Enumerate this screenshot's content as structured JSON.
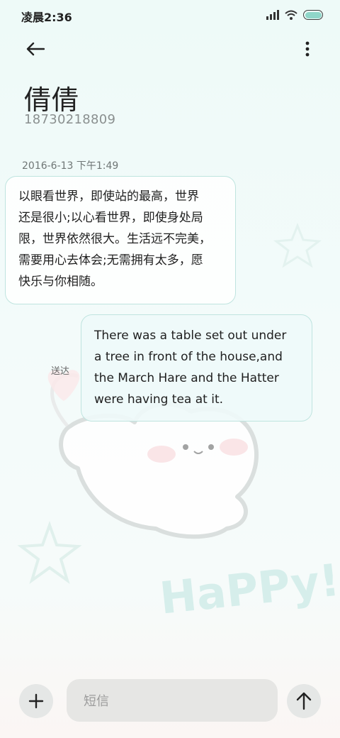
{
  "status_bar": {
    "time": "凌晨2:36",
    "icons": [
      "signal-icon",
      "wifi-icon",
      "battery-icon"
    ],
    "battery_color": "#8fd6c9"
  },
  "header": {
    "back_icon": "arrow-left-icon",
    "more_icon": "more-vertical-icon",
    "contact_name": "倩倩",
    "contact_number": "18730218809"
  },
  "conversation": {
    "timestamp": "2016-6-13 下午1:49",
    "messages": [
      {
        "direction": "incoming",
        "lines": [
          "以眼看世界，即使站的最高，世界",
          "还是很小;以心看世界，即使身处局",
          "限，世界依然很大。生活远不完美，",
          "需要用心去体会;无需拥有太多，愿",
          "快乐与你相随。"
        ]
      },
      {
        "direction": "outgoing",
        "status": "送达",
        "lines": [
          "There was a table set out under",
          "a tree in front of the house,and",
          "the March Hare and the Hatter",
          "were having tea at it."
        ]
      }
    ]
  },
  "wallpaper": {
    "decoration_text": "HaPPy!",
    "accent_color": "#cfeee9"
  },
  "composer": {
    "add_icon": "plus-icon",
    "placeholder": "短信",
    "send_icon": "arrow-up-icon"
  }
}
